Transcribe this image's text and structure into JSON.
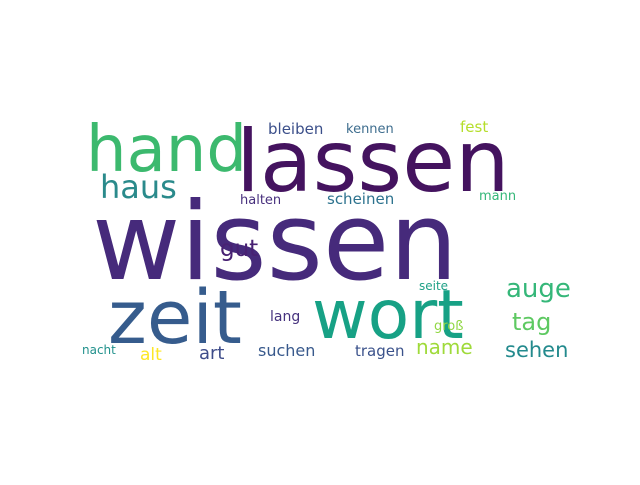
{
  "words": [
    {
      "text": "wissen",
      "color": "#462a7b"
    },
    {
      "text": "lassen",
      "color": "#44135f"
    },
    {
      "text": "hand",
      "color": "#3cb96e"
    },
    {
      "text": "wort",
      "color": "#17a185"
    },
    {
      "text": "zeit",
      "color": "#365c8d"
    },
    {
      "text": "haus",
      "color": "#2a8a8b"
    },
    {
      "text": "auge",
      "color": "#35b779"
    },
    {
      "text": "tag",
      "color": "#5ec962"
    },
    {
      "text": "gut",
      "color": "#482173"
    },
    {
      "text": "sehen",
      "color": "#238a8d"
    },
    {
      "text": "name",
      "color": "#9fda3a"
    },
    {
      "text": "art",
      "color": "#3e4c8a"
    },
    {
      "text": "alt",
      "color": "#fde725"
    },
    {
      "text": "suchen",
      "color": "#38598c"
    },
    {
      "text": "tragen",
      "color": "#3b528b"
    },
    {
      "text": "scheinen",
      "color": "#2c728e"
    },
    {
      "text": "bleiben",
      "color": "#3b4f8a"
    },
    {
      "text": "lang",
      "color": "#46327e"
    },
    {
      "text": "kennen",
      "color": "#3e6d8e"
    },
    {
      "text": "fest",
      "color": "#b5de2b"
    },
    {
      "text": "mann",
      "color": "#35b779"
    },
    {
      "text": "halten",
      "color": "#472f7d"
    },
    {
      "text": "seite",
      "color": "#1fa187"
    },
    {
      "text": "groß",
      "color": "#90d743"
    },
    {
      "text": "nacht",
      "color": "#21918c"
    }
  ]
}
